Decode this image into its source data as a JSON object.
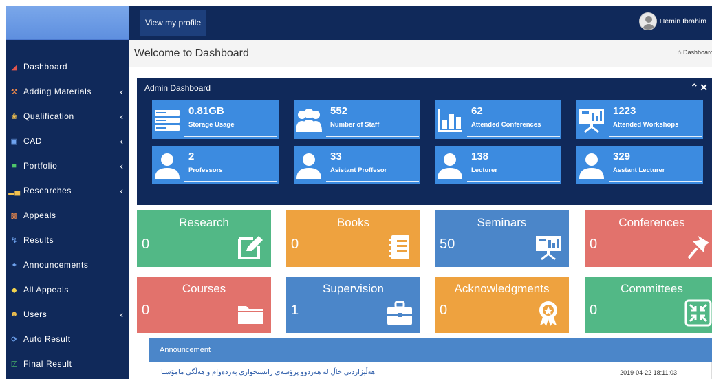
{
  "header": {
    "profile_button": "View my profile",
    "user_name": "Hemin Ibrahim"
  },
  "page": {
    "title": "Welcome to Dashboard",
    "breadcrumb": "Dashboard"
  },
  "sidebar": {
    "items": [
      {
        "label": "Dashboard",
        "icon": "home-icon",
        "has_arrow": false
      },
      {
        "label": "Adding Materials",
        "icon": "tools-icon",
        "has_arrow": true
      },
      {
        "label": "Qualification",
        "icon": "award-icon",
        "has_arrow": true
      },
      {
        "label": "CAD",
        "icon": "monitor-icon",
        "has_arrow": true
      },
      {
        "label": "Portfolio",
        "icon": "portfolio-icon",
        "has_arrow": true
      },
      {
        "label": "Researches",
        "icon": "bar-chart-icon",
        "has_arrow": true
      },
      {
        "label": "Appeals",
        "icon": "appeal-icon",
        "has_arrow": false
      },
      {
        "label": "Results",
        "icon": "bolt-icon",
        "has_arrow": false
      },
      {
        "label": "Announcements",
        "icon": "star-icon",
        "has_arrow": false
      },
      {
        "label": "All Appeals",
        "icon": "tag-icon",
        "has_arrow": false
      },
      {
        "label": "Users",
        "icon": "users-icon",
        "has_arrow": true
      },
      {
        "label": "Auto Result",
        "icon": "refresh-icon",
        "has_arrow": false
      },
      {
        "label": "Final Result",
        "icon": "check-square-icon",
        "has_arrow": false
      }
    ]
  },
  "admin": {
    "title": "Admin Dashboard",
    "stats": [
      {
        "value": "0.81GB",
        "label": "Storage Usage",
        "icon": "server-icon"
      },
      {
        "value": "552",
        "label": "Number of Staff",
        "icon": "group-icon"
      },
      {
        "value": "62",
        "label": "Attended Conferences",
        "icon": "bar-chart-icon"
      },
      {
        "value": "1223",
        "label": "Attended Workshops",
        "icon": "presentation-icon"
      },
      {
        "value": "2",
        "label": "Professors",
        "icon": "user-icon"
      },
      {
        "value": "33",
        "label": "Asistant Proffesor",
        "icon": "user-icon"
      },
      {
        "value": "138",
        "label": "Lecturer",
        "icon": "user-icon"
      },
      {
        "value": "329",
        "label": "Asstant Lecturer",
        "icon": "user-icon"
      }
    ]
  },
  "tiles": [
    {
      "title": "Research",
      "value": "0",
      "icon": "edit-icon",
      "color": "#52b886"
    },
    {
      "title": "Books",
      "value": "0",
      "icon": "notebook-icon",
      "color": "#eea23f"
    },
    {
      "title": "Seminars",
      "value": "50",
      "icon": "presentation-icon",
      "color": "#4b86c9"
    },
    {
      "title": "Conferences",
      "value": "0",
      "icon": "pushpin-icon",
      "color": "#e2726c"
    },
    {
      "title": "Courses",
      "value": "0",
      "icon": "folder-icon",
      "color": "#e2726c"
    },
    {
      "title": "Supervision",
      "value": "1",
      "icon": "briefcase-icon",
      "color": "#4b86c9"
    },
    {
      "title": "Acknowledgments",
      "value": "0",
      "icon": "medal-icon",
      "color": "#eea23f"
    },
    {
      "title": "Committees",
      "value": "0",
      "icon": "compress-icon",
      "color": "#52b886"
    }
  ],
  "announcement": {
    "title": "Announcement",
    "items": [
      {
        "text": "هەڵبژاردنی خاڵ لە هەردوو پرۆسەی زانستخوازی بەردەوام و هەڵگی مامۆستا",
        "date": "2019-04-22 18:11:03"
      }
    ]
  }
}
